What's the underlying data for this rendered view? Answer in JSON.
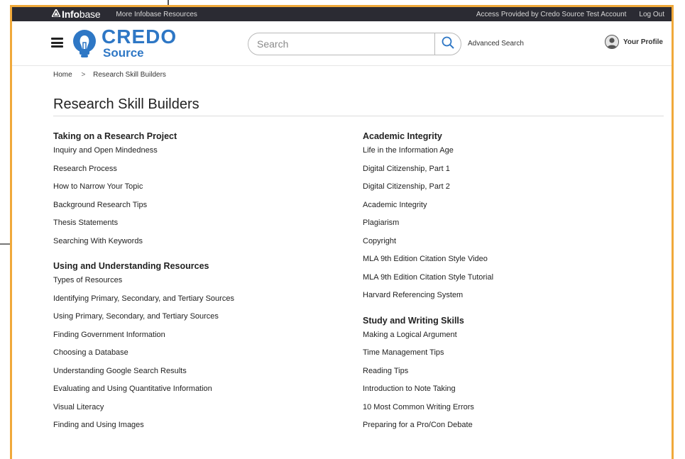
{
  "topbar": {
    "logo_text_bold": "Info",
    "logo_text_light": "base",
    "more_resources": "More Infobase Resources",
    "access": "Access Provided by Credo Source Test Account",
    "logout": "Log Out"
  },
  "header": {
    "brand_top": "CREDO",
    "brand_bottom": "Source",
    "search_placeholder": "Search",
    "advanced_search": "Advanced Search",
    "profile": "Your Profile"
  },
  "breadcrumb": {
    "home": "Home",
    "separator": ">",
    "current": "Research Skill Builders"
  },
  "page_title": "Research Skill Builders",
  "left_sections": [
    {
      "heading": "Taking on a Research Project",
      "links": [
        "Inquiry and Open Mindedness",
        "Research Process",
        "How to Narrow Your Topic",
        "Background Research Tips",
        "Thesis Statements",
        "Searching With Keywords"
      ]
    },
    {
      "heading": "Using and Understanding Resources",
      "links": [
        "Types of Resources",
        "Identifying Primary, Secondary, and Tertiary Sources",
        "Using Primary, Secondary, and Tertiary Sources",
        "Finding Government Information",
        "Choosing a Database",
        "Understanding Google Search Results",
        "Evaluating and Using Quantitative Information",
        "Visual Literacy",
        "Finding and Using Images"
      ]
    }
  ],
  "right_sections": [
    {
      "heading": "Academic Integrity",
      "links": [
        "Life in the Information Age",
        "Digital Citizenship, Part 1",
        "Digital Citizenship, Part 2",
        "Academic Integrity",
        "Plagiarism",
        "Copyright",
        "MLA 9th Edition Citation Style Video",
        "MLA 9th Edition Citation Style Tutorial",
        "Harvard Referencing System"
      ]
    },
    {
      "heading": "Study and Writing Skills",
      "links": [
        "Making a Logical Argument",
        "Time Management Tips",
        "Reading Tips",
        "Introduction to Note Taking",
        "10 Most Common Writing Errors",
        "Preparing for a Pro/Con Debate"
      ]
    }
  ],
  "colors": {
    "accent_border": "#f0a93a",
    "brand_blue": "#2e77c5",
    "topbar_bg": "#2b2b33"
  },
  "icons": {
    "logo": "infobase-triangle-icon",
    "brand": "lightbulb-icon",
    "search": "search-icon",
    "menu": "hamburger-icon",
    "avatar": "user-avatar-icon"
  }
}
